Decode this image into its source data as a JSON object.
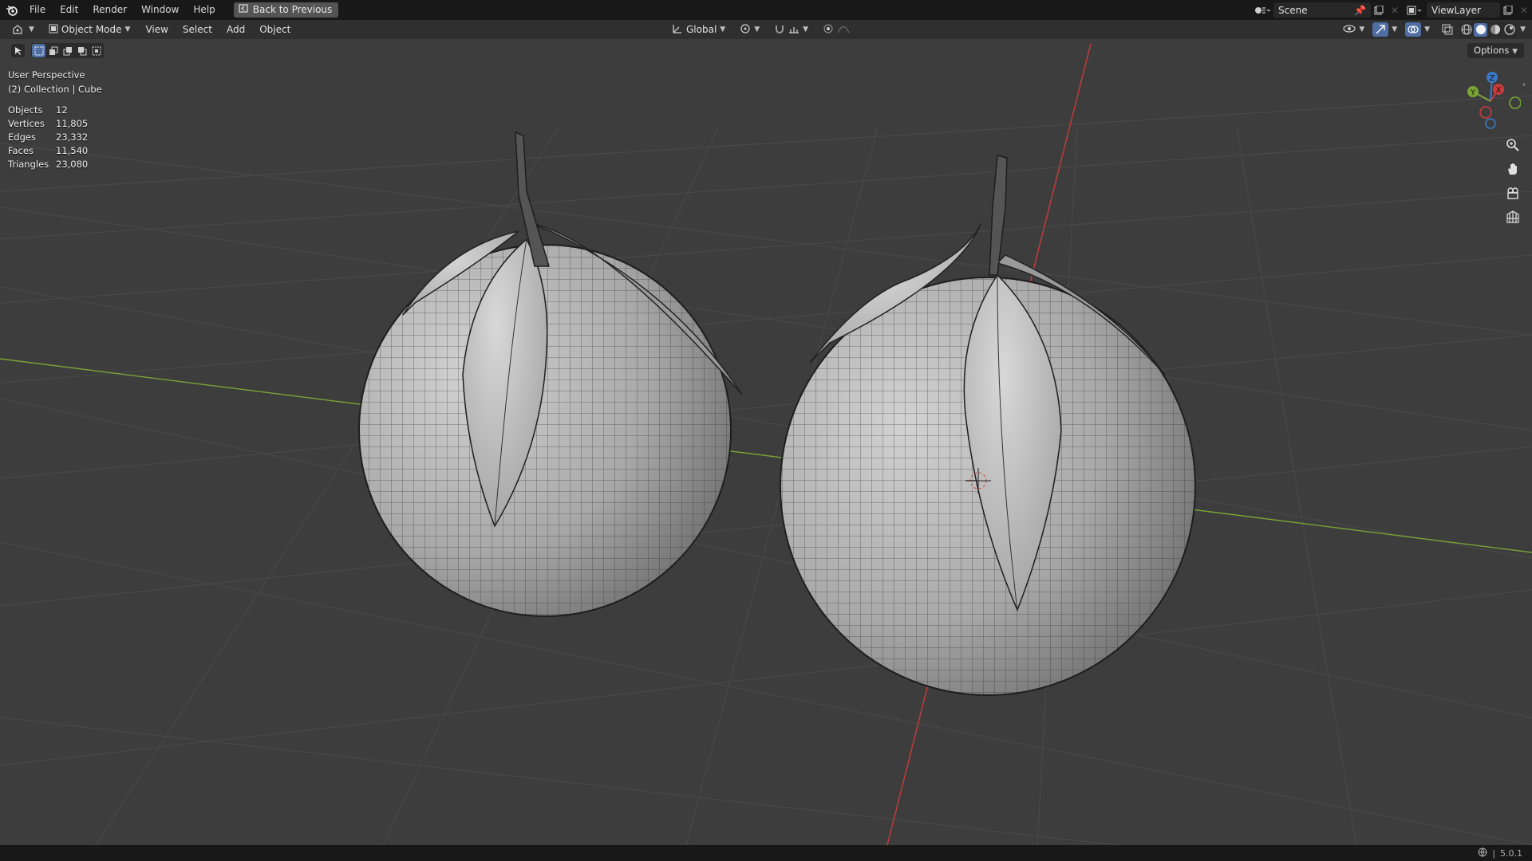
{
  "topbar": {
    "menus": [
      "File",
      "Edit",
      "Render",
      "Window",
      "Help"
    ],
    "back_label": "Back to Previous",
    "scene_label": "Scene",
    "viewlayer_label": "ViewLayer"
  },
  "header": {
    "mode_label": "Object Mode",
    "menus": [
      "View",
      "Select",
      "Add",
      "Object"
    ],
    "orientation_label": "Global",
    "options_label": "Options"
  },
  "viewport_info": {
    "perspective": "User Perspective",
    "collection": "(2) Collection | Cube"
  },
  "stats": [
    {
      "label": "Objects",
      "value": "12"
    },
    {
      "label": "Vertices",
      "value": "11,805"
    },
    {
      "label": "Edges",
      "value": "23,332"
    },
    {
      "label": "Faces",
      "value": "11,540"
    },
    {
      "label": "Triangles",
      "value": "23,080"
    }
  ],
  "gizmo": {
    "x": "X",
    "y": "Y",
    "z": "Z"
  },
  "status": {
    "version": "5.0.1"
  },
  "colors": {
    "x_axis": "#c93c3c",
    "y_axis": "#7aa536",
    "z_axis": "#3b79c6",
    "accent": "#4f6ea3"
  }
}
